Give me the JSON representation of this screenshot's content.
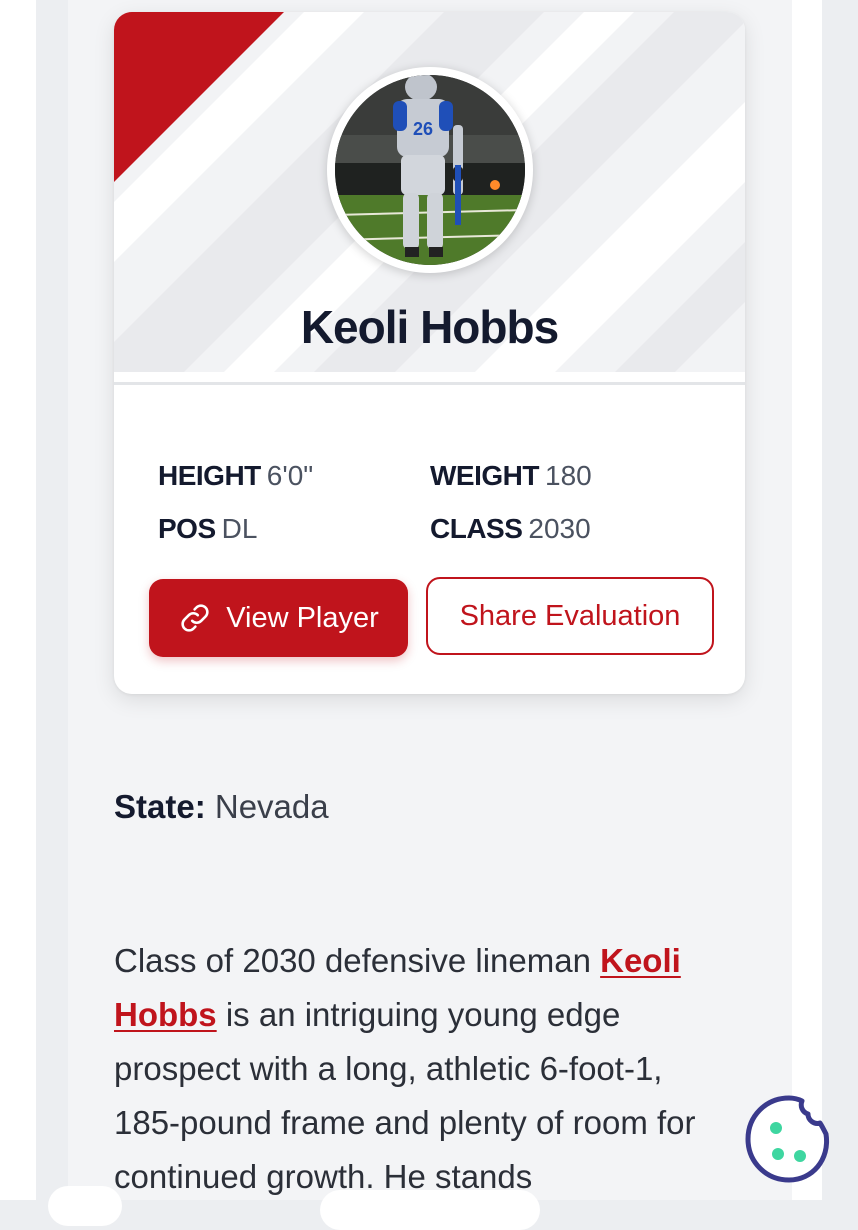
{
  "player": {
    "name": "Keoli Hobbs",
    "stats": [
      {
        "label": "HEIGHT",
        "value": "6'0\""
      },
      {
        "label": "WEIGHT",
        "value": "180"
      },
      {
        "label": "POS",
        "value": "DL"
      },
      {
        "label": "CLASS",
        "value": "2030"
      }
    ],
    "jersey_number": "26"
  },
  "buttons": {
    "view_player": "View Player",
    "share_evaluation": "Share Evaluation"
  },
  "article": {
    "state_label": "State:",
    "state_value": "Nevada",
    "paragraph_before": "Class of 2030 defensive lineman ",
    "player_link": "Keoli Hobbs",
    "paragraph_after": " is an intriguing young edge prospect with a long, athletic 6-foot-1, 185-pound frame and plenty of room for continued growth. He stands"
  },
  "colors": {
    "accent": "#c0141c",
    "name_text": "#141a2e",
    "cookie_accent": "#3a3a8c",
    "cookie_dots": "#3ed6a0"
  },
  "icons": {
    "view_player": "link-icon",
    "cookie": "cookie-icon"
  }
}
